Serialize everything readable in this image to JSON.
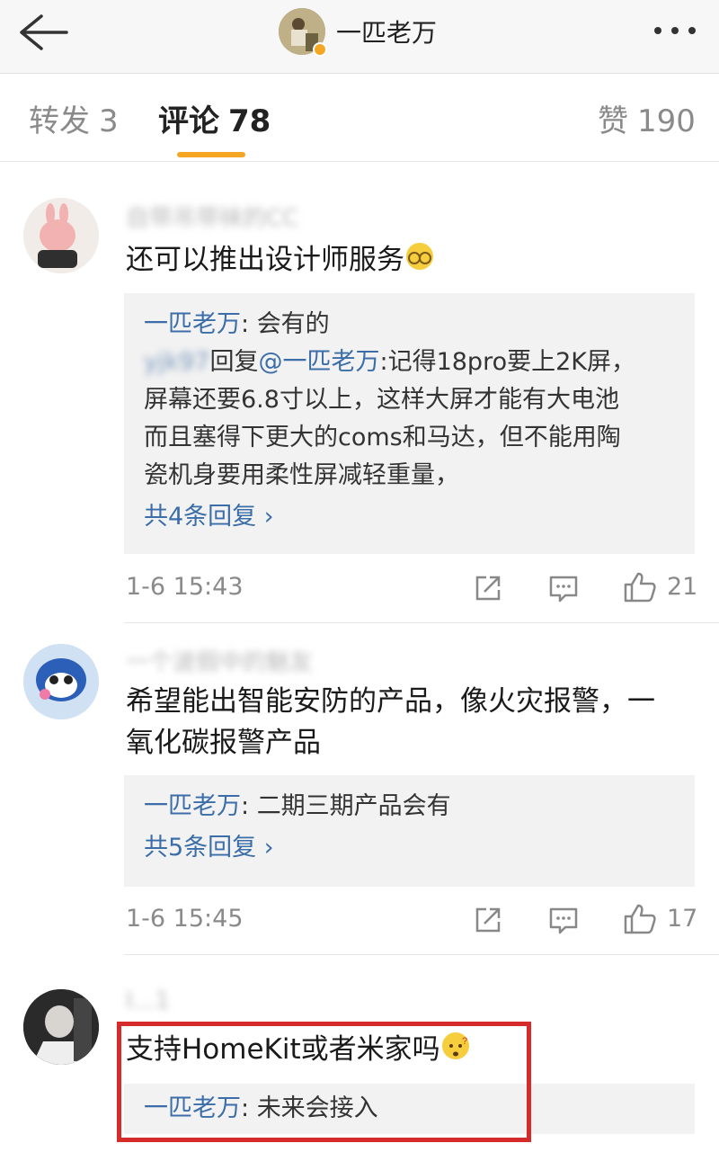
{
  "header": {
    "title": "一匹老万",
    "back_icon": "back-arrow-icon",
    "more_icon": "more-icon"
  },
  "tabs": [
    {
      "label": "转发",
      "count": "3"
    },
    {
      "label": "评论",
      "count": "78"
    },
    {
      "label": "赞",
      "count": "190"
    }
  ],
  "accent_color": "#f5a623",
  "comments": [
    {
      "user": "自带吊带袜的CC",
      "text": "还可以推出设计师服务",
      "reply": {
        "author": "一匹老万",
        "sep": ": ",
        "text": "会有的",
        "quote_user": "yjk97",
        "quote_prefix": "回复",
        "quote_mention": "@一匹老万",
        "quote_lines": [
          ":记得18pro要上2K屏，",
          "屏幕还要6.8寸以上，这样大屏才能有大电池",
          "而且塞得下更大的coms和马达，但不能用陶",
          "瓷机身要用柔性屏减轻重量，"
        ],
        "more": "共4条回复 ›"
      },
      "time": "1-6 15:43",
      "likes": "21"
    },
    {
      "user": "一个波假中的魅友",
      "text_lines": [
        "希望能出智能安防的产品，像火灾报警，一",
        "氧化碳报警产品"
      ],
      "reply": {
        "author": "一匹老万",
        "sep": ": ",
        "text": "二期三期产品会有",
        "more": "共5条回复 ›"
      },
      "time": "1-6 15:45",
      "likes": "17"
    },
    {
      "user": "I...1",
      "text": "支持HomeKit或者米家吗",
      "reply": {
        "author": "一匹老万",
        "sep": ": ",
        "text": "未来会接入"
      }
    }
  ]
}
